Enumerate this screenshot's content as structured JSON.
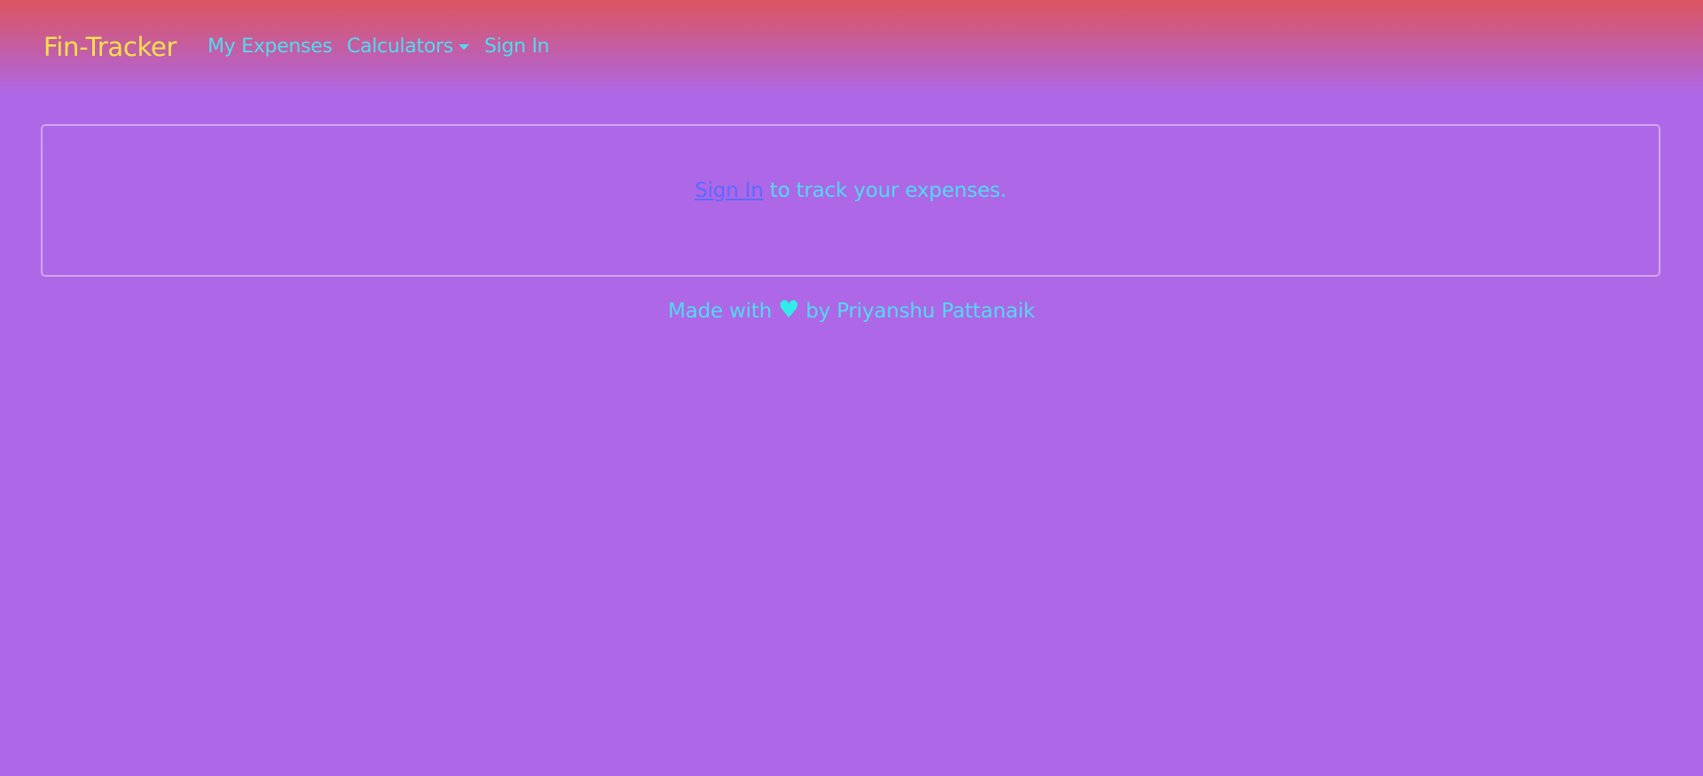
{
  "navbar": {
    "brand": "Fin-Tracker",
    "items": [
      {
        "label": "My Expenses"
      },
      {
        "label": "Calculators"
      },
      {
        "label": "Sign In"
      }
    ]
  },
  "card": {
    "link_text": "Sign In",
    "message": " to track your expenses."
  },
  "footer": {
    "prefix": "Made with ",
    "heart": "♥",
    "suffix": " by Priyanshu Pattanaik"
  },
  "colors": {
    "background": "#ae67e6",
    "brand": "#f5e24a",
    "nav_text": "#4fdcf0",
    "link": "#5a6bff",
    "heart": "#30ece8"
  }
}
